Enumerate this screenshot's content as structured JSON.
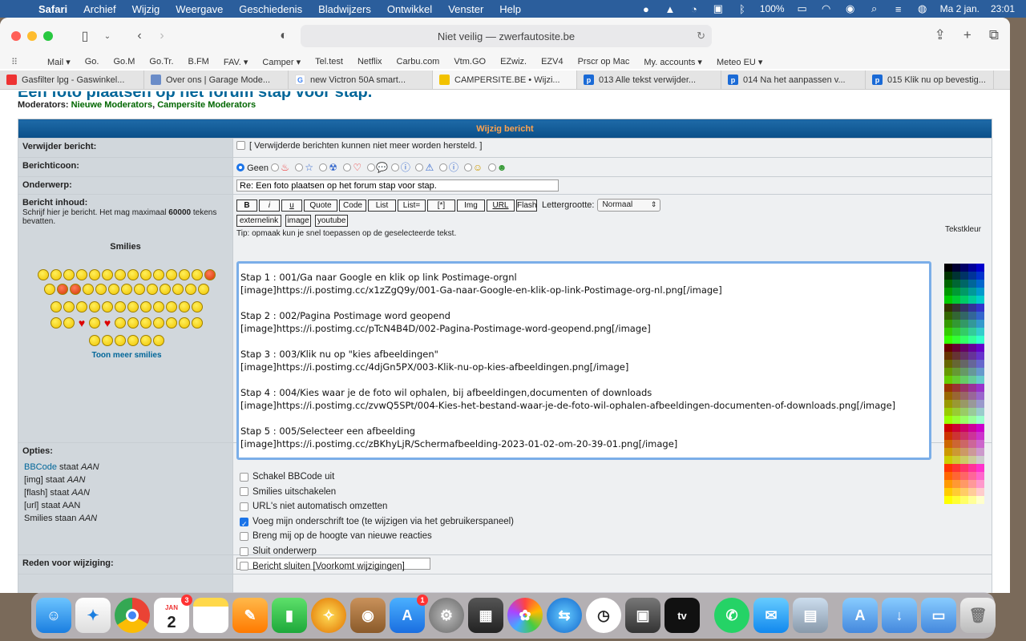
{
  "menubar": {
    "apple": "",
    "items": [
      "Safari",
      "Archief",
      "Wijzig",
      "Weergave",
      "Geschiedenis",
      "Bladwijzers",
      "Ontwikkel",
      "Venster",
      "Help"
    ],
    "battery": "100%",
    "date": "Ma 2 jan.",
    "time": "23:01"
  },
  "browser": {
    "address": "Niet veilig — zwerfautosite.be",
    "favorites": [
      "Mail ▾",
      "Go.",
      "Go.M",
      "Go.Tr.",
      "B.FM",
      "FAV. ▾",
      "Camper ▾",
      "Tel.test",
      "Netflix",
      "Carbu.com",
      "Vtm.GO",
      "EZwiz.",
      "EZV4",
      "Prscr op Mac",
      "My. accounts ▾",
      "Meteo EU ▾"
    ],
    "tabs": [
      {
        "label": "Gasfilter lpg - Gaswinkel...",
        "color": "#e33"
      },
      {
        "label": "Over ons | Garage Mode...",
        "color": "#6a8cc8"
      },
      {
        "label": "new Victron 50A smart...",
        "color": "#4285f4"
      },
      {
        "label": "CAMPERSITE.BE • Wijzi...",
        "color": "#f2c200"
      },
      {
        "label": "013 Alle tekst verwijder...",
        "color": "#1a6ad6"
      },
      {
        "label": "014 Na het aanpassen v...",
        "color": "#1a6ad6"
      },
      {
        "label": "015 Klik nu op bevestig...",
        "color": "#1a6ad6"
      }
    ]
  },
  "page": {
    "title": "Een foto plaatsen op het forum stap voor stap.",
    "moderators_label": "Moderators:",
    "moderators": [
      "Nieuwe Moderators",
      "Campersite Moderators"
    ],
    "header": "Wijzig bericht",
    "delete_label": "Verwijder bericht:",
    "delete_note": "[ Verwijderde berichten kunnen niet meer worden hersteld. ]",
    "icon_label": "Berichticoon:",
    "icon_none": "Geen",
    "subject_label": "Onderwerp:",
    "subject_value": "Re: Een foto plaatsen op het forum stap voor stap.",
    "content_label": "Bericht inhoud:",
    "content_hint": "Schrijf hier je bericht. Het mag maximaal ",
    "content_max": "60000",
    "content_hint2": " tekens bevatten.",
    "smilies_title": "Smilies",
    "more_smilies": "Toon meer smilies",
    "bb_buttons": [
      "B",
      "i",
      "u",
      "Quote",
      "Code",
      "List",
      "List=",
      "[*]",
      "Img",
      "URL",
      "Flash"
    ],
    "bb_buttons2": [
      "externelink",
      "image",
      "youtube"
    ],
    "font_size_label": "Lettergrootte:",
    "font_size_value": "Normaal",
    "tip": "Tip: opmaak kun je snel toepassen op de geselecteerde tekst.",
    "text_color_label": "Tekstkleur",
    "message": "Stap 1 : 001/Ga naar Google en klik op link Postimage-orgnl\n[image]https://i.postimg.cc/x1zZgQ9y/001-Ga-naar-Google-en-klik-op-link-Postimage-org-nl.png[/image]\n\nStap 2 : 002/Pagina Postimage word geopend\n[image]https://i.postimg.cc/pTcN4B4D/002-Pagina-Postimage-word-geopend.png[/image]\n\nStap 3 : 003/Klik nu op \"kies afbeeldingen\"\n[image]https://i.postimg.cc/4djGn5PX/003-Klik-nu-op-kies-afbeeldingen.png[/image]\n\nStap 4 : 004/Kies waar je de foto wil ophalen, bij afbeeldingen,documenten of downloads\n[image]https://i.postimg.cc/zvwQ5SPt/004-Kies-het-bestand-waar-je-de-foto-wil-ophalen-afbeeldingen-documenten-of-downloads.png[/image]\n\nStap 5 : 005/Selecteer een afbeelding\n[image]https://i.postimg.cc/zBKhyLjR/Schermafbeelding-2023-01-02-om-20-39-01.png[/image]",
    "options_label": "Opties:",
    "options_status": [
      {
        "link": "BBCode",
        "text": " staat ",
        "state": "AAN"
      },
      {
        "link": "",
        "text": "[img] staat ",
        "state": "AAN"
      },
      {
        "link": "",
        "text": "[flash] staat ",
        "state": "AAN"
      },
      {
        "link": "",
        "text": "[url] staat AAN",
        "state": ""
      },
      {
        "link": "",
        "text": "Smilies staan ",
        "state": "AAN"
      }
    ],
    "option_checks": [
      {
        "label": "Schakel BBCode uit",
        "checked": false
      },
      {
        "label": "Smilies uitschakelen",
        "checked": false
      },
      {
        "label": "URL's niet automatisch omzetten",
        "checked": false
      },
      {
        "label": "Voeg mijn onderschrift toe (te wijzigen via het gebruikerspaneel)",
        "checked": true
      },
      {
        "label": "Breng mij op de hoogte van nieuwe reacties",
        "checked": false
      },
      {
        "label": "Sluit onderwerp",
        "checked": false
      },
      {
        "label": "Bericht sluiten [Voorkomt wijzigingen]",
        "checked": false
      }
    ],
    "reason_label": "Reden voor wijziging:"
  },
  "dock": {
    "calendar_month": "JAN",
    "calendar_day": "2",
    "calendar_badge": "3",
    "appstore_badge": "1",
    "appletv": "tv"
  }
}
